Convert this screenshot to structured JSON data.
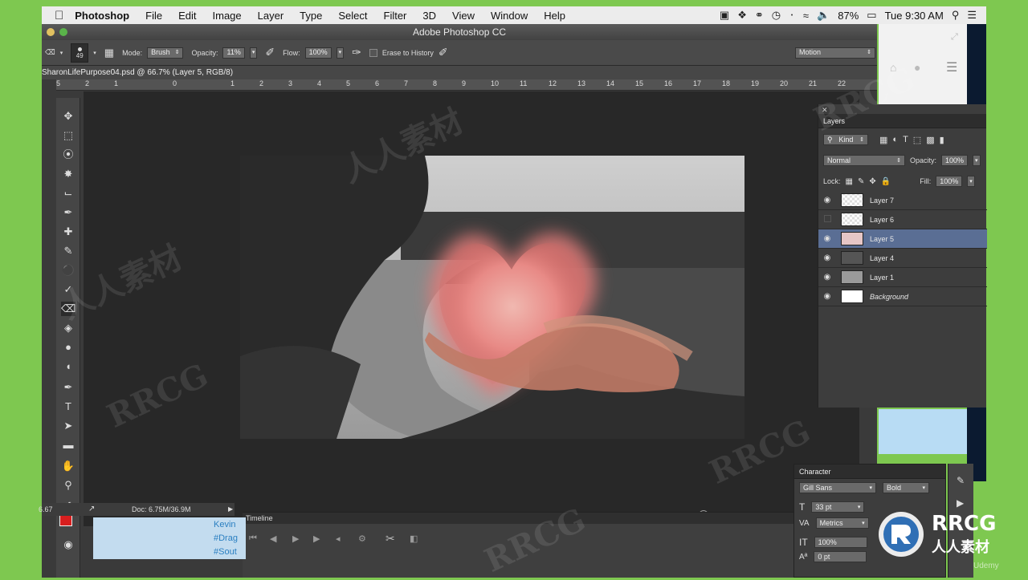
{
  "menubar": {
    "app": "Photoshop",
    "items": [
      "File",
      "Edit",
      "Image",
      "Layer",
      "Type",
      "Select",
      "Filter",
      "3D",
      "View",
      "Window",
      "Help"
    ],
    "battery": "87%",
    "clock": "Tue 9:30 AM"
  },
  "window": {
    "title": "Adobe Photoshop CC"
  },
  "options": {
    "brush_size": "49",
    "mode_label": "Mode:",
    "mode_value": "Brush",
    "opacity_label": "Opacity:",
    "opacity_value": "11%",
    "flow_label": "Flow:",
    "flow_value": "100%",
    "erase_history": "Erase to History",
    "workspace": "Motion"
  },
  "document": {
    "tab": "SharonLifePurpose04.psd @ 66.7% (Layer 5, RGB/8)",
    "status": "Doc: 6.75M/36.9M",
    "zoom": "6.67"
  },
  "ruler": [
    "5",
    "2",
    "1",
    "0",
    "1",
    "2",
    "3",
    "4",
    "5",
    "6",
    "7",
    "8",
    "9",
    "10",
    "11",
    "12",
    "13",
    "14",
    "15",
    "16",
    "17",
    "18",
    "19",
    "20",
    "21",
    "22"
  ],
  "layers_panel": {
    "title": "Layers",
    "kind": "Kind",
    "blend_mode": "Normal",
    "opacity_label": "Opacity:",
    "opacity_value": "100%",
    "lock_label": "Lock:",
    "fill_label": "Fill:",
    "fill_value": "100%",
    "layers": [
      {
        "name": "Layer 7",
        "visible": true,
        "selected": false
      },
      {
        "name": "Layer 6",
        "visible": false,
        "selected": false
      },
      {
        "name": "Layer 5",
        "visible": true,
        "selected": true
      },
      {
        "name": "Layer 4",
        "visible": true,
        "selected": false
      },
      {
        "name": "Layer 1",
        "visible": true,
        "selected": false
      },
      {
        "name": "Background",
        "visible": true,
        "selected": false
      }
    ]
  },
  "timeline": {
    "title": "Timeline"
  },
  "character_panel": {
    "title": "Character",
    "font": "Gill Sans",
    "style": "Bold",
    "size": "33 pt",
    "kerning": "Metrics",
    "scale": "100%",
    "baseline": "0 pt"
  },
  "tweet": {
    "lines": [
      "Kevin",
      "#Drag",
      "#Sout"
    ]
  },
  "watermark": {
    "brand": "RRCG",
    "cn": "人人素材",
    "udemy": "Udemy"
  }
}
